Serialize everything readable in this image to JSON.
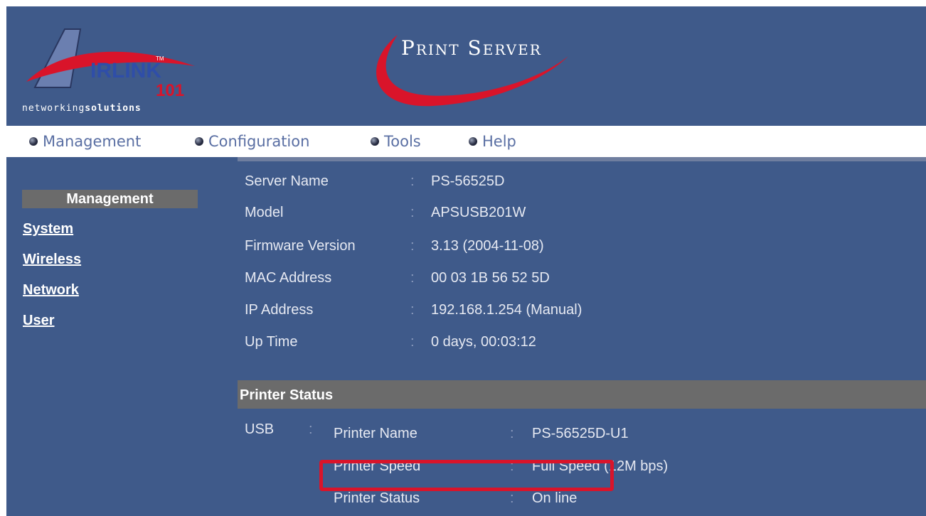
{
  "brand": {
    "logo_text_main": "IRLINK",
    "logo_text_num": "101",
    "logo_tm": "TM",
    "tagline_light": "networking",
    "tagline_bold": "solutions",
    "product_title": "Print Server",
    "accent_red": "#d9142a",
    "page_blue": "#3f5a8a"
  },
  "nav": {
    "items": [
      {
        "label": "Management"
      },
      {
        "label": "Configuration"
      },
      {
        "label": "Tools"
      },
      {
        "label": "Help"
      }
    ]
  },
  "sidebar": {
    "heading": "Management",
    "links": [
      {
        "label": "System"
      },
      {
        "label": "Wireless"
      },
      {
        "label": "Network"
      },
      {
        "label": "User"
      }
    ]
  },
  "server_info": {
    "separator": ":",
    "rows": [
      {
        "label": "Server Name",
        "value": "PS-56525D"
      },
      {
        "label": "Model",
        "value": "APSUSB201W"
      },
      {
        "label": "Firmware Version",
        "value": "3.13 (2004-11-08)"
      },
      {
        "label": "MAC Address",
        "value": "00 03 1B 56 52 5D"
      },
      {
        "label": "IP Address",
        "value": "192.168.1.254 (Manual)"
      },
      {
        "label": "Up Time",
        "value": "0 days, 00:03:12"
      }
    ]
  },
  "printer_status": {
    "title": "Printer Status",
    "port": "USB",
    "separator": ":",
    "rows": [
      {
        "label": "Printer Name",
        "value": "PS-56525D-U1"
      },
      {
        "label": "Printer Speed",
        "value": "Full Speed (12M bps)"
      },
      {
        "label": "Printer Status",
        "value": "On line"
      }
    ]
  }
}
